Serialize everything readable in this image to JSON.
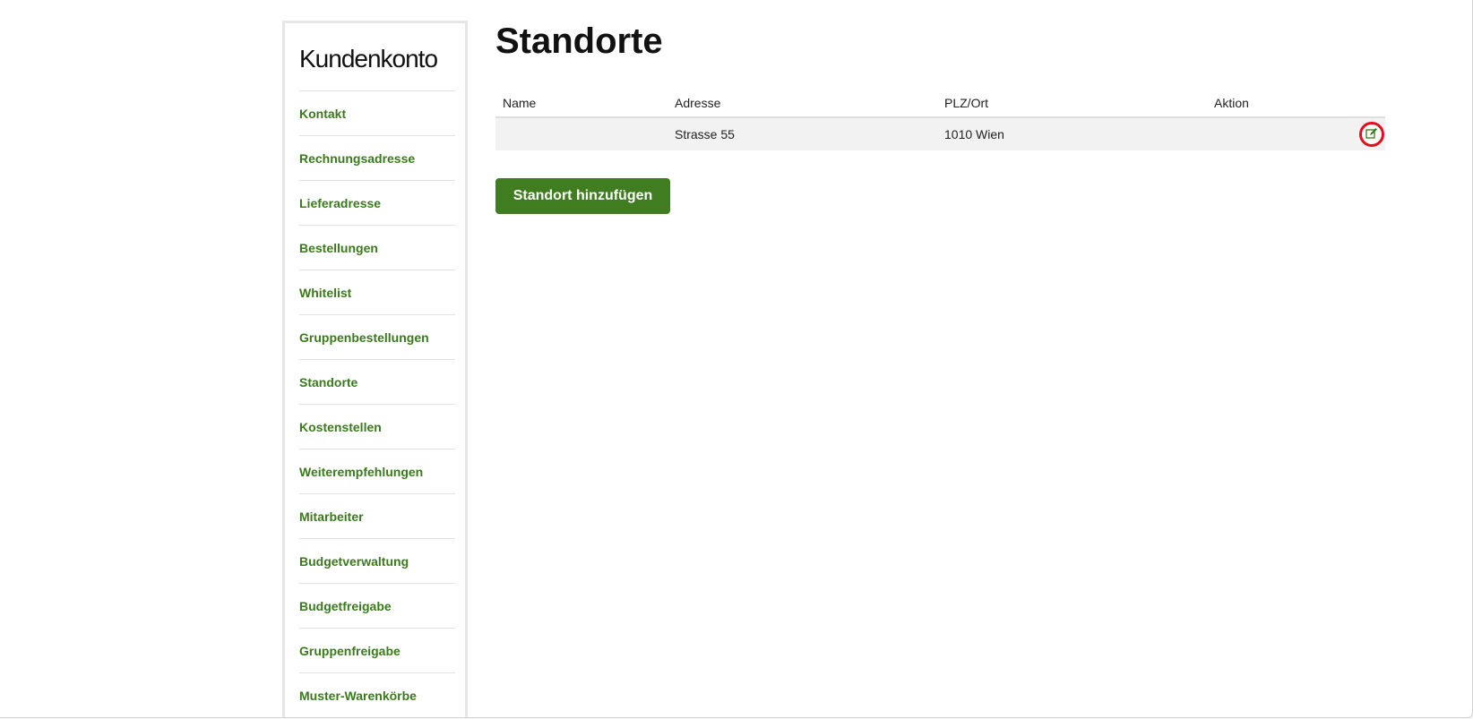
{
  "sidebar": {
    "title": "Kundenkonto",
    "items": [
      {
        "label": "Kontakt"
      },
      {
        "label": "Rechnungsadresse"
      },
      {
        "label": "Lieferadresse"
      },
      {
        "label": "Bestellungen"
      },
      {
        "label": "Whitelist"
      },
      {
        "label": "Gruppenbestellungen"
      },
      {
        "label": "Standorte"
      },
      {
        "label": "Kostenstellen"
      },
      {
        "label": "Weiterempfehlungen"
      },
      {
        "label": "Mitarbeiter"
      },
      {
        "label": "Budgetverwaltung"
      },
      {
        "label": "Budgetfreigabe"
      },
      {
        "label": "Gruppenfreigabe"
      },
      {
        "label": "Muster-Warenkörbe"
      }
    ]
  },
  "main": {
    "title": "Standorte",
    "table": {
      "headers": {
        "name": "Name",
        "adresse": "Adresse",
        "plz": "PLZ/Ort",
        "aktion": "Aktion"
      },
      "rows": [
        {
          "name": "",
          "adresse": "Strasse 55",
          "plz": "1010 Wien"
        }
      ]
    },
    "add_button_label": "Standort hinzufügen"
  },
  "colors": {
    "accent_green": "#3f7d20",
    "link_green": "#3a7a1c",
    "highlight_red": "#e0101e"
  }
}
